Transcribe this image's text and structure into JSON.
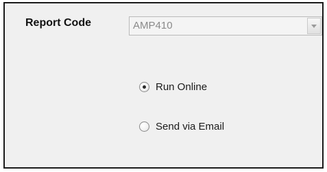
{
  "form": {
    "report_code_label": "Report Code",
    "report_code_value": "AMP410",
    "dropdown_icon": "chevron-down-icon",
    "options": [
      {
        "label": "Run Online",
        "selected": true
      },
      {
        "label": "Send via Email",
        "selected": false
      }
    ]
  },
  "colors": {
    "panel_background": "#f0f0f0",
    "border": "#1a1a1a",
    "disabled_text": "#8a8a8a"
  }
}
